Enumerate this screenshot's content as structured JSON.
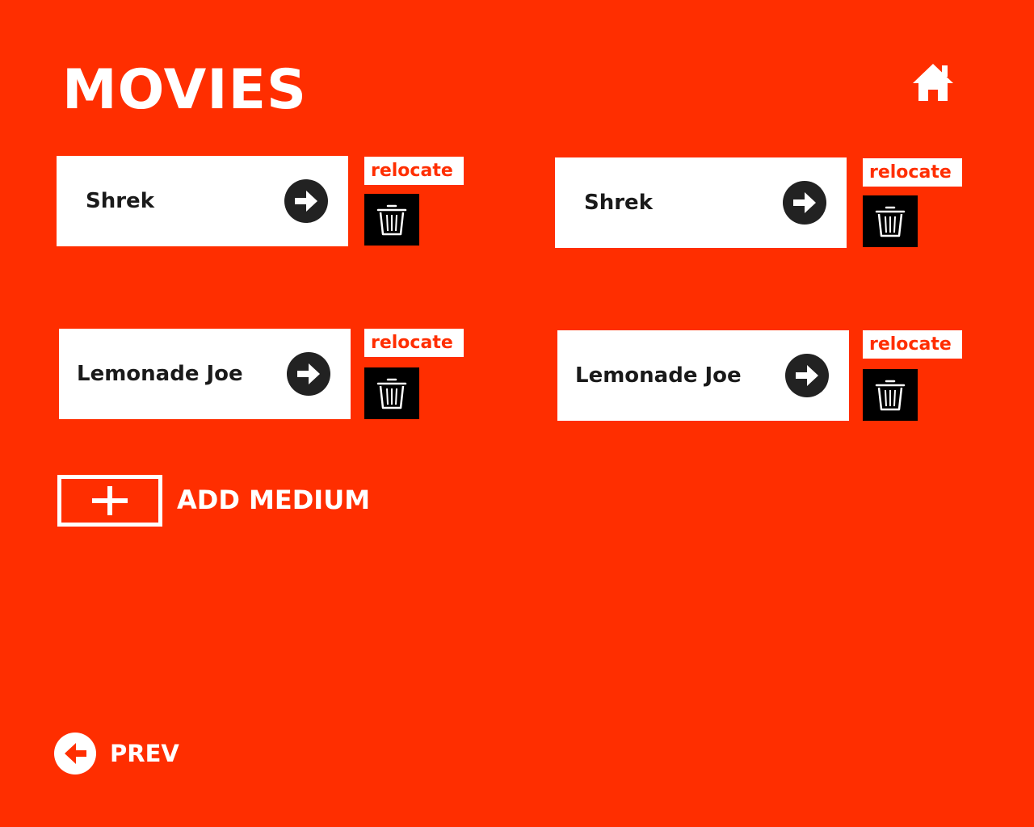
{
  "header": {
    "title": "MOVIES",
    "home_icon": "home-icon"
  },
  "media": [
    {
      "title": "Shrek",
      "relocate_label": "relocate",
      "open_icon": "arrow-right-circle-icon",
      "delete_icon": "trash-icon"
    },
    {
      "title": "Shrek",
      "relocate_label": "relocate",
      "open_icon": "arrow-right-circle-icon",
      "delete_icon": "trash-icon"
    },
    {
      "title": "Lemonade Joe",
      "relocate_label": "relocate",
      "open_icon": "arrow-right-circle-icon",
      "delete_icon": "trash-icon"
    },
    {
      "title": "Lemonade Joe",
      "relocate_label": "relocate",
      "open_icon": "arrow-right-circle-icon",
      "delete_icon": "trash-icon"
    }
  ],
  "add_medium": {
    "label": "ADD MEDIUM",
    "icon": "plus-icon"
  },
  "navigation": {
    "prev_label": "PREV",
    "prev_icon": "arrow-left-circle-icon"
  },
  "colors": {
    "background": "#ff2e00",
    "card": "#ffffff",
    "text_dark": "#1a1a1a",
    "delete_button": "#000000",
    "accent": "#ff2e00"
  }
}
